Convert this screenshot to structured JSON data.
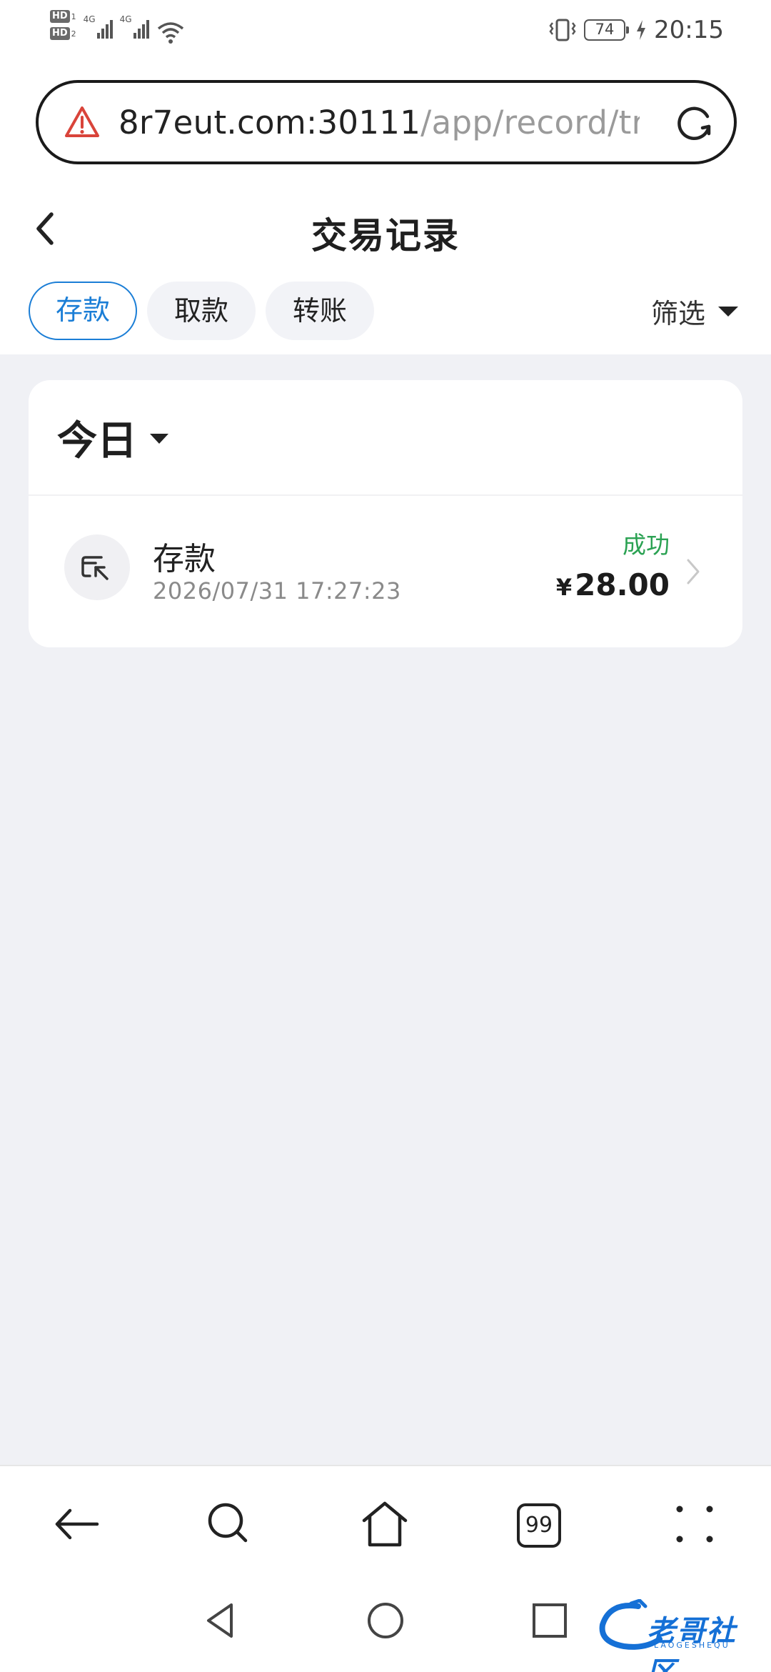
{
  "status_bar": {
    "sim1": "HD",
    "sim1_index": "1",
    "sim2": "HD",
    "sim2_index": "2",
    "network1": "4G",
    "network2": "4G",
    "battery": "74",
    "time": "20:15",
    "icons": [
      "signal-icon",
      "wifi-icon",
      "vibrate-icon",
      "battery-icon",
      "charging-icon"
    ]
  },
  "browser": {
    "url_host": "8r7eut.com:30111",
    "url_path": "/app/record/tra",
    "tabs_count": "99",
    "icons": [
      "warning-icon",
      "reload-icon",
      "back-arrow-icon",
      "search-icon",
      "home-icon",
      "tabs-icon",
      "more-icon"
    ]
  },
  "header": {
    "title": "交易记录"
  },
  "tabs": [
    {
      "label": "存款",
      "active": true
    },
    {
      "label": "取款",
      "active": false
    },
    {
      "label": "转账",
      "active": false
    }
  ],
  "filter": {
    "label": "筛选"
  },
  "records": {
    "day_label": "今日",
    "items": [
      {
        "type": "存款",
        "time": "2026/07/31 17:27:23",
        "status": "成功",
        "currency": "¥",
        "amount": "28.00"
      }
    ]
  },
  "watermark": {
    "text": "老哥社区",
    "sub": "LAOGESHEQU"
  },
  "colors": {
    "accent": "#1b7ed6",
    "success": "#2ba253",
    "background": "#f0f1f5"
  }
}
